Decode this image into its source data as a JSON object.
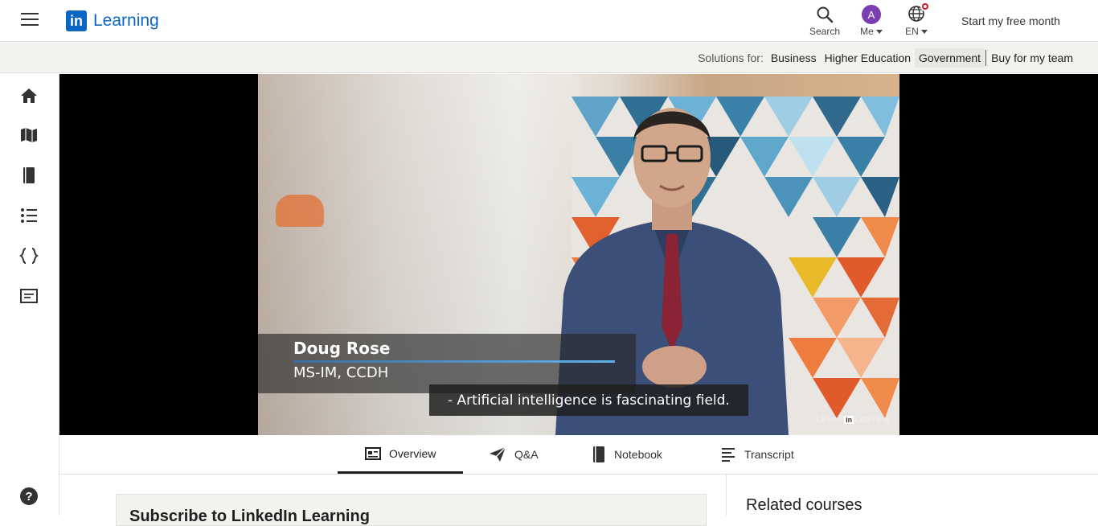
{
  "header": {
    "logo_mark": "in",
    "logo_text": "Learning",
    "search_label": "Search",
    "me_label": "Me",
    "avatar_letter": "A",
    "lang_label": "EN",
    "cta_label": "Start my free month"
  },
  "solutions": {
    "label": "Solutions for:",
    "links": [
      "Business",
      "Higher Education",
      "Government",
      "Buy for my team"
    ],
    "active": "Government"
  },
  "sidebar": {
    "icons": [
      "home-icon",
      "map-icon",
      "book-icon",
      "list-icon",
      "code-braces-icon",
      "certificate-icon"
    ],
    "help_glyph": "?"
  },
  "video": {
    "lower_third_name": "Doug Rose",
    "lower_third_title": "MS-IM, CCDH",
    "caption": "- Artificial intelligence is fascinating field.",
    "watermark_left": "Linked",
    "watermark_mark": "in",
    "watermark_right": "Learning"
  },
  "tabs": [
    {
      "label": "Overview",
      "icon": "overview-icon",
      "active": true
    },
    {
      "label": "Q&A",
      "icon": "send-icon",
      "active": false
    },
    {
      "label": "Notebook",
      "icon": "notebook-icon",
      "active": false
    },
    {
      "label": "Transcript",
      "icon": "transcript-icon",
      "active": false
    }
  ],
  "content": {
    "subscribe_heading": "Subscribe to LinkedIn Learning",
    "related_heading": "Related courses"
  },
  "colors": {
    "brand": "#0a66c2",
    "avatar": "#7a3eb1",
    "notification": "#d11124"
  }
}
